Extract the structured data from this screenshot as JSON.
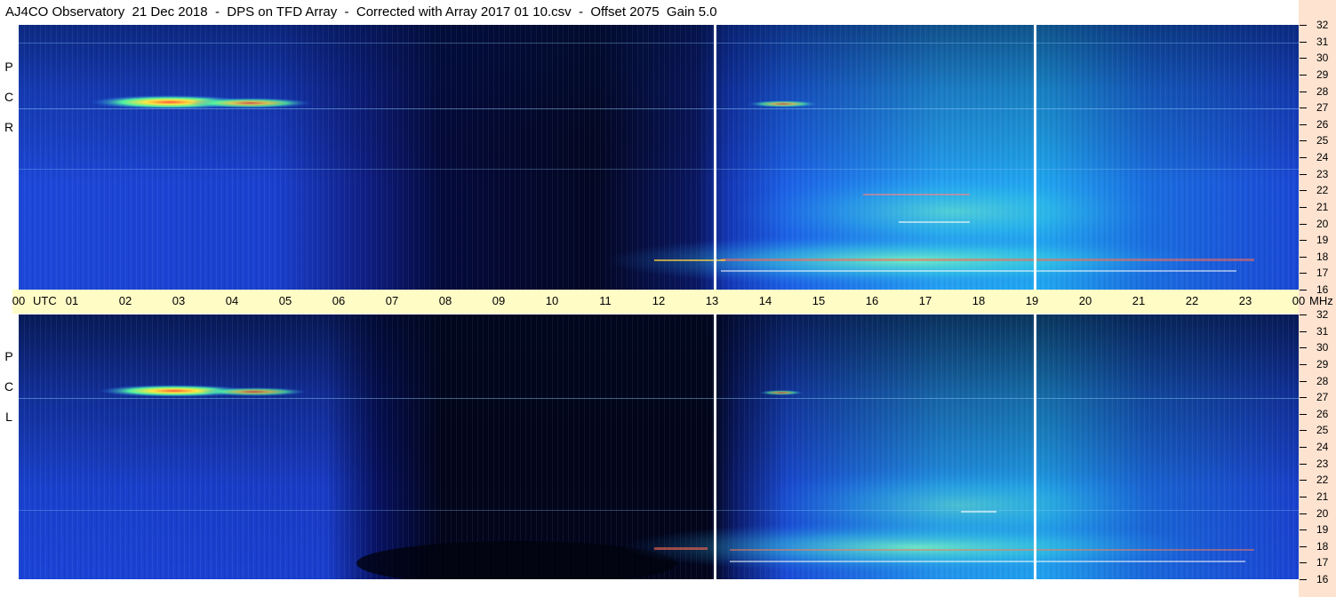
{
  "title": "AJ4CO Observatory  21 Dec 2018  -  DPS on TFD Array  -  Corrected with Array 2017 01 10.csv  -  Offset 2075  Gain 5.0",
  "time_axis": {
    "start_label": "00",
    "utc_label": "UTC",
    "unit_label": "MHz",
    "hours": [
      "01",
      "02",
      "03",
      "04",
      "05",
      "06",
      "07",
      "08",
      "09",
      "10",
      "11",
      "12",
      "13",
      "14",
      "15",
      "16",
      "17",
      "18",
      "19",
      "20",
      "21",
      "22",
      "23",
      "00"
    ]
  },
  "colors": {
    "background": "#ffffff",
    "time_band": "#fffcc6",
    "right_strip": "#fde3d0",
    "spectrogram_base": "#1a44d8",
    "dark_region": "#020418",
    "hot": "#66ff99"
  },
  "chart_data": [
    {
      "type": "heatmap",
      "name": "RCP",
      "side_label": [
        "R",
        "C",
        "P"
      ],
      "x_range_utc_hours": [
        0,
        24
      ],
      "y_range_mhz": [
        16,
        32
      ],
      "y_ticks": [
        "32",
        "31",
        "30",
        "29",
        "28",
        "27",
        "26",
        "25",
        "24",
        "23",
        "22",
        "21",
        "20",
        "19",
        "18",
        "17",
        "16"
      ],
      "data_gaps_utc_hours": [
        13.0,
        19.0
      ]
    },
    {
      "type": "heatmap",
      "name": "LCP",
      "side_label": [
        "L",
        "C",
        "P"
      ],
      "x_range_utc_hours": [
        0,
        24
      ],
      "y_range_mhz": [
        16,
        32
      ],
      "y_ticks": [
        "32",
        "31",
        "30",
        "29",
        "28",
        "27",
        "26",
        "25",
        "24",
        "23",
        "22",
        "21",
        "20",
        "19",
        "18",
        "17",
        "16"
      ],
      "data_gaps_utc_hours": [
        13.0,
        19.0
      ]
    }
  ]
}
